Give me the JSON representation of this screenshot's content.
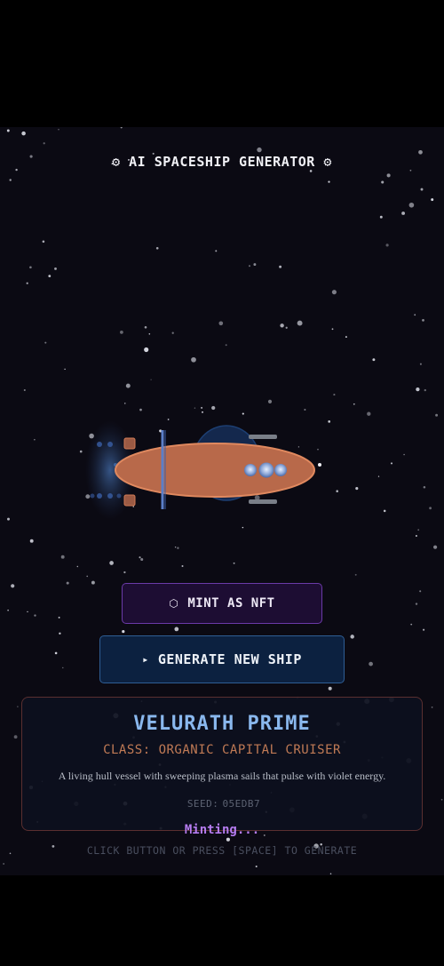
{
  "app": {
    "title": "⚙ AI SPACESHIP GENERATOR ⚙"
  },
  "actions": {
    "mint_icon": "⬡",
    "mint_label": "MINT AS NFT",
    "generate_icon": "▸",
    "generate_label": "GENERATE NEW SHIP"
  },
  "ship": {
    "name": "VELURATH PRIME",
    "class_line": "CLASS: ORGANIC CAPITAL CRUISER",
    "description": "A living hull vessel with sweeping plasma sails that pulse with violet energy.",
    "seed_label": "SEED:",
    "seed_value": "05EDB7"
  },
  "status": {
    "minting": "Minting...",
    "hint": "CLICK BUTTON OR PRESS [SPACE] TO GENERATE"
  },
  "colors": {
    "background": "#0b0a13",
    "hull": "#b8694a",
    "hull_outline": "#e0895f",
    "shield": "#1d3f73",
    "mint_accent": "#6b3aa8",
    "generate_accent": "#2f5e95",
    "name_color": "#8ab8ee",
    "class_color": "#c07a55",
    "minting_color": "#b57cf0"
  },
  "icons": {
    "title": "gear-icon",
    "mint": "hexagon-icon",
    "generate": "play-icon"
  }
}
